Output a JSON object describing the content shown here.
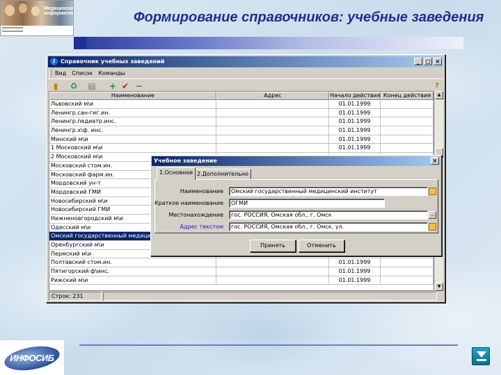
{
  "slide": {
    "title": "Формирование справочников: учебные заведения",
    "logo_caption": "Медицинская информатика",
    "footer_logo": "ИНФОСИБ"
  },
  "window": {
    "title": "Справочник учебных заведений",
    "menu": [
      "Вид",
      "Список",
      "Команды"
    ],
    "toolbar_icons": [
      "book-icon",
      "refresh-icon",
      "print-icon",
      "add-icon",
      "check-icon",
      "remove-icon",
      "help-icon"
    ],
    "columns": [
      "Наименование",
      "Адрес",
      "Начало действия",
      "Конец действия"
    ],
    "rows": [
      {
        "name": "Львовский м\\и",
        "address": "",
        "start": "01.01.1999",
        "end": ""
      },
      {
        "name": "Ленингр.сан-гиг.ин.",
        "address": "",
        "start": "01.01.1999",
        "end": ""
      },
      {
        "name": "Ленингр.педиатр.инс.",
        "address": "",
        "start": "01.01.1999",
        "end": ""
      },
      {
        "name": "Ленингр.х\\ф. инс.",
        "address": "",
        "start": "01.01.1999",
        "end": ""
      },
      {
        "name": "Минский м\\и",
        "address": "",
        "start": "01.01.1999",
        "end": ""
      },
      {
        "name": "1 Московский м\\и",
        "address": "",
        "start": "01.01.1999",
        "end": ""
      },
      {
        "name": "2 Московский м\\и",
        "address": "",
        "start": "",
        "end": ""
      },
      {
        "name": "Московский стом.ин.",
        "address": "",
        "start": "",
        "end": ""
      },
      {
        "name": "Московский фарм.ин.",
        "address": "",
        "start": "",
        "end": ""
      },
      {
        "name": "Мордовский ун-т",
        "address": "",
        "start": "",
        "end": ""
      },
      {
        "name": "Мордовский ГМИ",
        "address": "",
        "start": "",
        "end": ""
      },
      {
        "name": "Новосибирский м\\и",
        "address": "",
        "start": "",
        "end": ""
      },
      {
        "name": "Новосибирский ГМИ",
        "address": "",
        "start": "",
        "end": ""
      },
      {
        "name": "Нижненовгородский м\\и",
        "address": "",
        "start": "",
        "end": ""
      },
      {
        "name": "Одесский м\\и",
        "address": "",
        "start": "",
        "end": ""
      },
      {
        "name": "Омский государственный медицинский",
        "address": "",
        "start": "",
        "end": "",
        "selected": true
      },
      {
        "name": "Оренбургский м\\и",
        "address": "",
        "start": "",
        "end": ""
      },
      {
        "name": "Пермский м\\и",
        "address": "",
        "start": "",
        "end": ""
      },
      {
        "name": "Полтавский стом.ин.",
        "address": "",
        "start": "01.01.1999",
        "end": ""
      },
      {
        "name": "Пятигорский ф\\инс.",
        "address": "",
        "start": "01.01.1999",
        "end": ""
      },
      {
        "name": "Рижский м\\и",
        "address": "",
        "start": "01.01.1999",
        "end": ""
      }
    ],
    "status": {
      "count_label": "Строк: 231"
    }
  },
  "dialog": {
    "title": "Учебное заведение",
    "tabs": [
      "1.Основное",
      "2.Дополнительно"
    ],
    "fields": {
      "name_label": "Наименование",
      "name_value": "Омский государственный медицинский институт",
      "short_label": "Краткое наименование",
      "short_value": "ОГМИ",
      "location_label": "Местонахождение",
      "location_value": "гос. РОССИЯ, Омская обл., г. Омск",
      "address_label": "Адрес текстом",
      "address_value": "гос. РОССИЯ, Омская обл., г. Омск, ул."
    },
    "ok_label": "Принять",
    "cancel_label": "Отменить"
  }
}
